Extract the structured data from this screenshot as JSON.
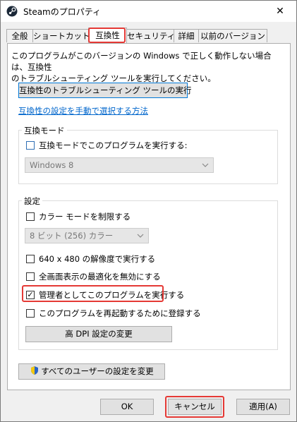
{
  "window": {
    "title": "Steamのプロパティ",
    "close_glyph": "✕"
  },
  "tabs": [
    {
      "label": "全般"
    },
    {
      "label": "ショートカット"
    },
    {
      "label": "互換性"
    },
    {
      "label": "セキュリティ"
    },
    {
      "label": "詳細"
    },
    {
      "label": "以前のバージョン"
    }
  ],
  "compat": {
    "description_line1": "このプログラムがこのバージョンの Windows で正しく動作しない場合は、互換性",
    "description_line2": "のトラブルシューティング ツールを実行してください。",
    "troubleshoot_button": "互換性のトラブルシューティング ツールの実行",
    "manual_link": "互換性の設定を手動で選択する方法"
  },
  "compat_mode": {
    "legend": "互換モード",
    "checkbox_label": "互換モードでこのプログラムを実行する:",
    "selected_os": "Windows 8"
  },
  "settings": {
    "legend": "設定",
    "color_mode_label": "カラー モードを制限する",
    "color_select": "8 ビット (256) カラー",
    "res_label": "640 x 480 の解像度で実行する",
    "fullscreen_label": "全画面表示の最適化を無効にする",
    "admin_label": "管理者としてこのプログラムを実行する",
    "restart_label": "このプログラムを再起動するために登録する",
    "dpi_button": "高 DPI 設定の変更",
    "admin_checked_glyph": "✓"
  },
  "all_users_button": "すべてのユーザーの設定を変更",
  "footer": {
    "ok": "OK",
    "cancel": "キャンセル",
    "apply": "適用(A)"
  },
  "colors": {
    "accent": "#0078d7",
    "highlight": "#e53935",
    "link": "#0066cc"
  }
}
